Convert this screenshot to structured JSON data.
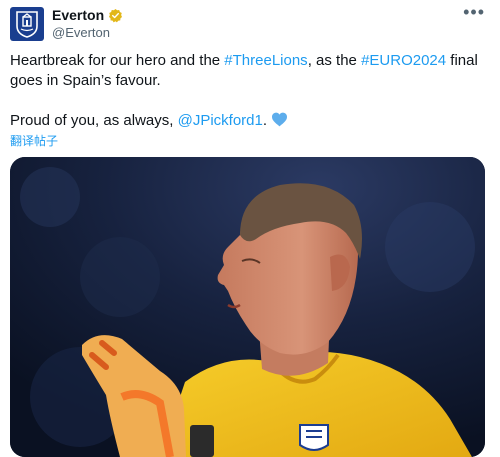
{
  "author": {
    "display_name": "Everton",
    "handle": "@Everton",
    "verified_icon": "gold-verified-badge",
    "avatar_icon": "everton-crest"
  },
  "more_label": "•••",
  "tweet": {
    "line1_prefix": "Heartbreak for our hero and the ",
    "hashtag1": "#ThreeLions",
    "line1_mid": ", as the ",
    "hashtag2": "#EURO2024",
    "line1_suffix": " final goes in Spain’s favour.",
    "line2_prefix": "Proud of you, as always, ",
    "mention": "@JPickford1",
    "line2_suffix": ". ",
    "emoji_icon": "blue-heart-icon"
  },
  "translate_label": "翻译帖子",
  "media": {
    "description_icon": "photo-goalkeeper"
  },
  "colors": {
    "link": "#1d9bf0",
    "text": "#0f1419",
    "secondary": "#536471",
    "badge": "#e2b719",
    "jersey": "#f3c21a"
  }
}
